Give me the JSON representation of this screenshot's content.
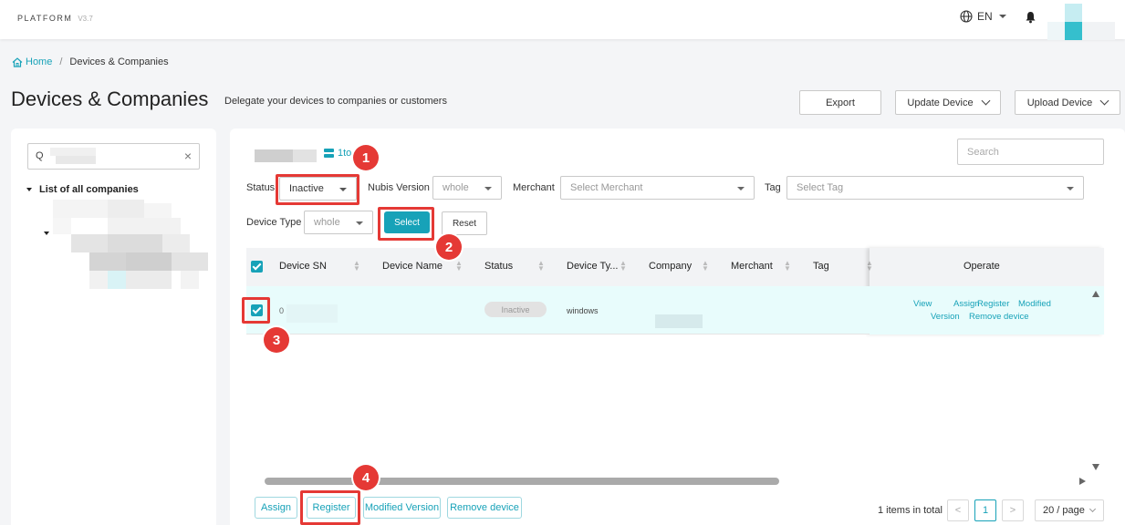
{
  "topbar": {
    "brand": "PLATFORM",
    "version": "V3.7",
    "language": "EN"
  },
  "breadcrumb": {
    "home": "Home",
    "separator": "/",
    "current": "Devices & Companies"
  },
  "page": {
    "title": "Devices & Companies",
    "subtitle": "Delegate your devices to companies or customers"
  },
  "header_buttons": {
    "export": "Export",
    "update_device": "Update Device",
    "upload_device": "Upload Device"
  },
  "left_panel": {
    "search_prefix": "Q",
    "tree_root": "List of all companies"
  },
  "main": {
    "count_fragment": "1to",
    "search_placeholder": "Search",
    "filters": {
      "status_label": "Status",
      "status_value": "Inactive",
      "nubis_label": "Nubis Version",
      "nubis_value": "whole",
      "merchant_label": "Merchant",
      "merchant_placeholder": "Select Merchant",
      "tag_label": "Tag",
      "tag_placeholder": "Select Tag",
      "device_type_label": "Device Type",
      "device_type_value": "whole",
      "select_button": "Select",
      "reset_button": "Reset"
    },
    "table": {
      "columns": [
        "Device SN",
        "Device Name",
        "Status",
        "Device Ty...",
        "Company",
        "Merchant",
        "Tag",
        "Operate"
      ],
      "row": {
        "device_sn": "0",
        "status": "Inactive",
        "device_type": "windows",
        "operate": [
          "View",
          "Assign",
          "Register",
          "Modified",
          "Version",
          "Remove device"
        ]
      }
    },
    "bulk_actions": {
      "assign": "Assign",
      "register": "Register",
      "modified_version": "Modified Version",
      "remove_device": "Remove device"
    },
    "pagination": {
      "total": "1 items in total",
      "prev": "<",
      "current": "1",
      "next": ">",
      "per_page": "20 / page"
    }
  },
  "annotations": {
    "step1": "1",
    "step2": "2",
    "step3": "3",
    "step4": "4",
    "color": "#e53935"
  },
  "colors": {
    "accent": "#17a2b8",
    "row_highlight": "#e8fcfc"
  }
}
